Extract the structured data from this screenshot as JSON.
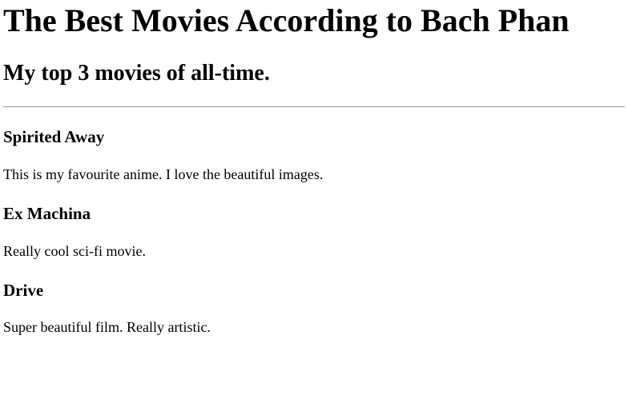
{
  "header": {
    "title": "The Best Movies According to Bach Phan",
    "subtitle": "My top 3 movies of all-time."
  },
  "movies": [
    {
      "title": "Spirited Away",
      "description": "This is my favourite anime. I love the beautiful images."
    },
    {
      "title": "Ex Machina",
      "description": "Really cool sci-fi movie."
    },
    {
      "title": "Drive",
      "description": "Super beautiful film. Really artistic."
    }
  ]
}
